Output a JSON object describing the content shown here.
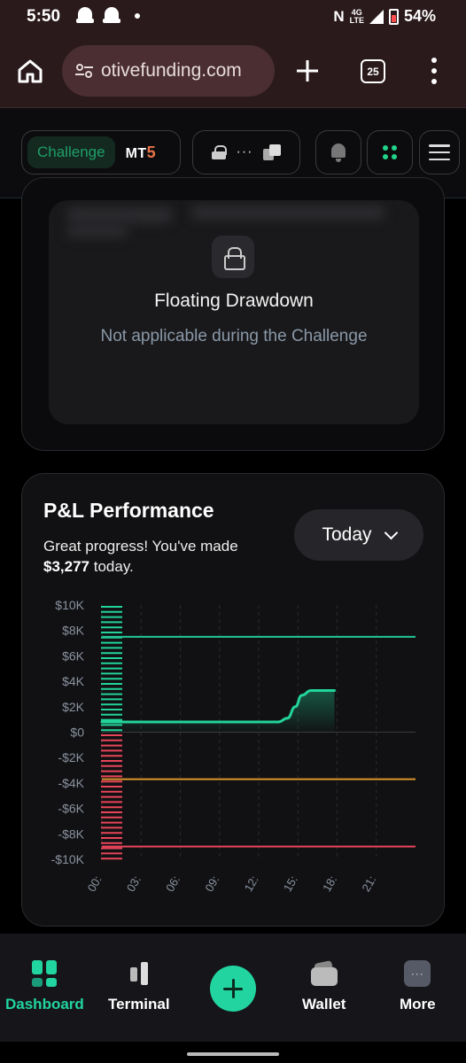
{
  "status_bar": {
    "time": "5:50",
    "network_n": "N",
    "network_type": "4G",
    "network_lte": "LTE",
    "battery": "54%"
  },
  "browser": {
    "url": "otivefunding.com",
    "tab_count": "25"
  },
  "app_header": {
    "mode_label": "Challenge",
    "platform_prefix": "MT",
    "platform_version": "5",
    "account_masked": "···"
  },
  "drawdown_card": {
    "title": "Floating Drawdown",
    "subtitle": "Not applicable during the Challenge"
  },
  "pl_card": {
    "title": "P&L Performance",
    "desc_prefix": "Great progress! You've made",
    "desc_amount": "$3,277",
    "desc_suffix": "today.",
    "period_label": "Today"
  },
  "chart_data": {
    "type": "area",
    "y_ticks": [
      "$10K",
      "$8K",
      "$6K",
      "$4K",
      "$2K",
      "$0",
      "-$2K",
      "-$4K",
      "-$6K",
      "-$8K",
      "-$10K"
    ],
    "x_ticks": [
      "00:",
      "03:",
      "06:",
      "09:",
      "12:",
      "15:",
      "18:",
      "21:"
    ],
    "ylim": [
      -10000,
      10000
    ],
    "xlim": [
      0,
      24
    ],
    "series": [
      {
        "values": [
          [
            0,
            800
          ],
          [
            3,
            800
          ],
          [
            6,
            800
          ],
          [
            9,
            800
          ],
          [
            12,
            800
          ],
          [
            13.5,
            800
          ],
          [
            14.2,
            1100
          ],
          [
            14.8,
            2000
          ],
          [
            15.3,
            2900
          ],
          [
            16,
            3277
          ],
          [
            17.8,
            3277
          ]
        ]
      }
    ],
    "reference_lines": [
      {
        "value": 7500,
        "color": "#22c79a"
      },
      {
        "value": -3700,
        "color": "#d9962a"
      },
      {
        "value": -9000,
        "color": "#e8455a"
      }
    ],
    "colors": {
      "line": "#22d49a",
      "positive_ticks": "#22d49a",
      "negative_ticks": "#e8455a"
    }
  },
  "bottom_nav": {
    "items": [
      {
        "label": "Dashboard",
        "active": true
      },
      {
        "label": "Terminal"
      },
      {
        "label": "Wallet"
      },
      {
        "label": "More"
      }
    ]
  },
  "colors": {
    "accent": "#22d4a0",
    "background": "#000000",
    "card": "#111113"
  }
}
